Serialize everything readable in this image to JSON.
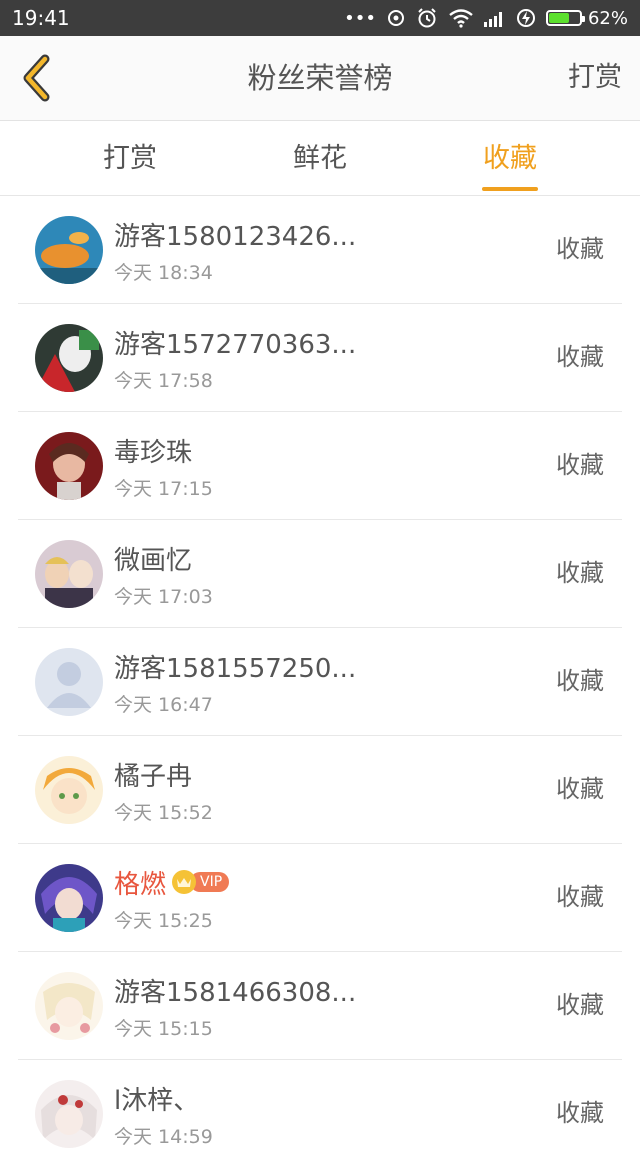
{
  "status_bar": {
    "time": "19:41",
    "dots": "•••",
    "battery_percent": "62%",
    "battery_level": 0.62
  },
  "header": {
    "back_icon": "chevron-left-icon",
    "title": "粉丝荣誉榜",
    "action_label": "打赏"
  },
  "tabs": [
    {
      "label": "打赏",
      "active": false
    },
    {
      "label": "鲜花",
      "active": false
    },
    {
      "label": "收藏",
      "active": true
    }
  ],
  "accent_color": "#f0a01e",
  "fans": [
    {
      "name": "游客1580123426...",
      "time": "今天 18:34",
      "action": "收藏",
      "vip": false
    },
    {
      "name": "游客1572770363...",
      "time": "今天 17:58",
      "action": "收藏",
      "vip": false
    },
    {
      "name": "毒珍珠",
      "time": "今天 17:15",
      "action": "收藏",
      "vip": false
    },
    {
      "name": "微画忆",
      "time": "今天 17:03",
      "action": "收藏",
      "vip": false
    },
    {
      "name": "游客1581557250...",
      "time": "今天 16:47",
      "action": "收藏",
      "vip": false
    },
    {
      "name": "橘子冉",
      "time": "今天 15:52",
      "action": "收藏",
      "vip": false
    },
    {
      "name": "格燃",
      "time": "今天 15:25",
      "action": "收藏",
      "vip": true,
      "vip_label": "VIP"
    },
    {
      "name": "游客1581466308...",
      "time": "今天 15:15",
      "action": "收藏",
      "vip": false
    },
    {
      "name": "l沐梓、",
      "time": "今天 14:59",
      "action": "收藏",
      "vip": false
    }
  ]
}
